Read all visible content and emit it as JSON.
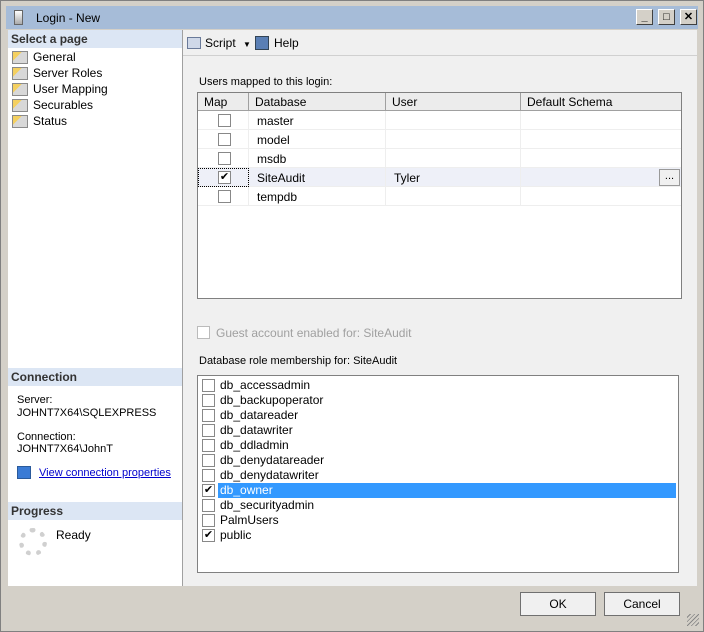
{
  "window": {
    "title": "Login - New",
    "minimize": "_",
    "maximize": "□",
    "close": "✕"
  },
  "sidebar": {
    "select_header": "Select a page",
    "items": [
      {
        "label": "General"
      },
      {
        "label": "Server Roles"
      },
      {
        "label": "User Mapping"
      },
      {
        "label": "Securables"
      },
      {
        "label": "Status"
      }
    ],
    "connection_header": "Connection",
    "server_label": "Server:",
    "server_value": "JOHNT7X64\\SQLEXPRESS",
    "connection_label": "Connection:",
    "connection_value": "JOHNT7X64\\JohnT",
    "view_link": "View connection properties",
    "progress_header": "Progress",
    "progress_status": "Ready"
  },
  "toolbar": {
    "script": "Script",
    "help": "Help"
  },
  "mapping": {
    "label": "Users mapped to this login:",
    "columns": [
      "Map",
      "Database",
      "User",
      "Default Schema"
    ],
    "rows": [
      {
        "map": false,
        "database": "master",
        "user": "",
        "schema": ""
      },
      {
        "map": false,
        "database": "model",
        "user": "",
        "schema": ""
      },
      {
        "map": false,
        "database": "msdb",
        "user": "",
        "schema": ""
      },
      {
        "map": true,
        "database": "SiteAudit",
        "user": "Tyler",
        "schema": "",
        "browse": "..."
      },
      {
        "map": false,
        "database": "tempdb",
        "user": "",
        "schema": ""
      }
    ]
  },
  "guest": {
    "label": "Guest account enabled for: SiteAudit",
    "checked": false
  },
  "roles": {
    "label": "Database role membership for: SiteAudit",
    "items": [
      {
        "name": "db_accessadmin",
        "checked": false
      },
      {
        "name": "db_backupoperator",
        "checked": false
      },
      {
        "name": "db_datareader",
        "checked": false
      },
      {
        "name": "db_datawriter",
        "checked": false
      },
      {
        "name": "db_ddladmin",
        "checked": false
      },
      {
        "name": "db_denydatareader",
        "checked": false
      },
      {
        "name": "db_denydatawriter",
        "checked": false
      },
      {
        "name": "db_owner",
        "checked": true,
        "selected": true
      },
      {
        "name": "db_securityadmin",
        "checked": false
      },
      {
        "name": "PalmUsers",
        "checked": false
      },
      {
        "name": "public",
        "checked": true
      }
    ]
  },
  "buttons": {
    "ok": "OK",
    "cancel": "Cancel"
  }
}
